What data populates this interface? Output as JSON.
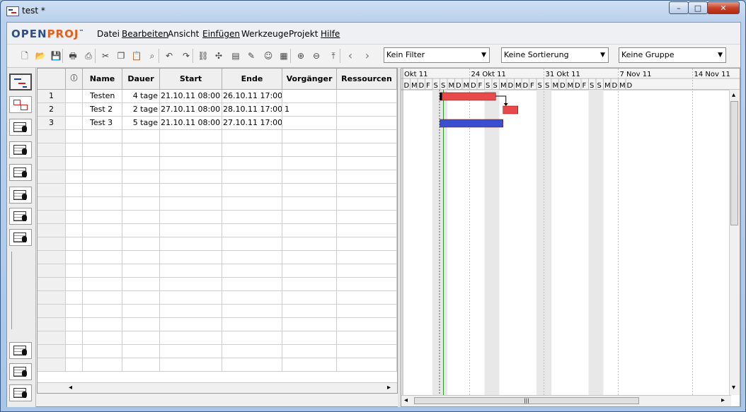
{
  "window": {
    "title": "test *",
    "buttons": {
      "minimize": "–",
      "maximize": "□",
      "close": "✕"
    }
  },
  "logo": {
    "part1": "OPEN",
    "part2": "PROJ",
    "tm": "™"
  },
  "menu": [
    "Datei",
    "Bearbeiten",
    "Ansicht",
    "Einfügen",
    "Werkzeuge",
    "Projekt",
    "Hilfe"
  ],
  "toolbar": {
    "icons": [
      "new-document-icon",
      "open-icon",
      "save-icon",
      "print-icon",
      "print-preview-icon",
      "cut-icon",
      "copy-icon",
      "paste-icon",
      "find-icon",
      "undo-icon",
      "redo-icon",
      "link-icon",
      "unlink-icon",
      "task-info-icon",
      "task-notes-icon",
      "assign-resource-icon",
      "calendar-icon",
      "zoom-in-icon",
      "zoom-out-icon",
      "scroll-to-task-icon",
      "prev-icon",
      "next-icon"
    ],
    "filter": "Kein Filter",
    "sort": "Keine Sortierung",
    "group": "Keine Gruppe"
  },
  "sidebar": {
    "icons": [
      "gantt-view-icon",
      "network-view-icon",
      "resource-sheet-icon",
      "wbs-view-icon",
      "rbs-view-icon",
      "project-sheet-icon",
      "report-icon",
      "resource-usage-icon",
      "histogram-icon",
      "charts-icon",
      "task-usage-icon",
      "resource-usage-2-icon"
    ]
  },
  "table": {
    "headers": [
      "",
      "ⓘ",
      "Name",
      "Dauer",
      "Start",
      "Ende",
      "Vorgänger",
      "Ressourcen"
    ],
    "rows": [
      {
        "num": "1",
        "name": "Testen",
        "dauer": "4 tage",
        "start": "21.10.11 08:00",
        "ende": "26.10.11 17:00",
        "vorg": "",
        "res": ""
      },
      {
        "num": "2",
        "name": "Test 2",
        "dauer": "2 tage",
        "start": "27.10.11 08:00",
        "ende": "28.10.11 17:00",
        "vorg": "1",
        "res": ""
      },
      {
        "num": "3",
        "name": "Test 3",
        "dauer": "5 tage",
        "start": "21.10.11 08:00",
        "ende": "27.10.11 17:00",
        "vorg": "",
        "res": ""
      }
    ]
  },
  "gantt": {
    "weeks": [
      "Okt 11",
      "24 Okt 11",
      "31 Okt 11",
      "7 Nov 11",
      "14 Nov 11"
    ],
    "day_letters": [
      "D",
      "M",
      "D",
      "F",
      "S",
      "S",
      "M",
      "D",
      "M",
      "D",
      "F",
      "S",
      "S",
      "M",
      "D",
      "M",
      "D",
      "F",
      "S",
      "S",
      "M",
      "D",
      "M",
      "D",
      "F",
      "S",
      "S",
      "M",
      "D",
      "M",
      "D"
    ],
    "colors": {
      "critical": "#e84a4a",
      "normal": "#3a4fd0",
      "weekend": "#e8e8e8",
      "today_line": "#2a9a2a"
    }
  },
  "scrollbar": {
    "left_arrow": "◂",
    "right_arrow": "▸",
    "up_arrow": "▴",
    "down_arrow": "▾",
    "grip": "|||"
  }
}
